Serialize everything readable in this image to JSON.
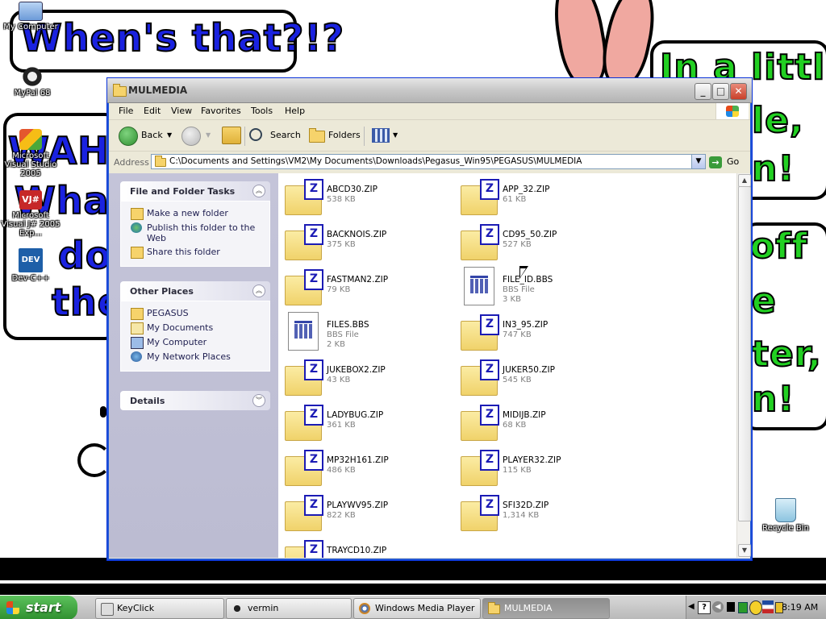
{
  "desktop": {
    "icons": [
      {
        "label": "My Computer"
      },
      {
        "label": "MyPal 68"
      },
      {
        "label": "Microsoft Visual Studio 2005"
      },
      {
        "label": "Microsoft Visual J# 2005 Exp..."
      },
      {
        "label": "Dev-C++"
      },
      {
        "label": "Recycle Bin"
      }
    ],
    "wallpaper_text": {
      "bubble1": "When's that?!?",
      "bubble2_line1": "WAHU",
      "bubble2_line2": "What",
      "bubble2_line3": "do",
      "bubble2_line4": "the",
      "bubble3_line1": "In a little",
      "bubble3_line2": "le,",
      "bubble3_line3": "n!",
      "bubble4_line1": "off",
      "bubble4_line2": "e",
      "bubble4_line3": "ter,",
      "bubble4_line4": "n!"
    }
  },
  "window": {
    "title": "MULMEDIA",
    "controls": {
      "minimize": "_",
      "maximize": "□",
      "close": "✕"
    },
    "menu": [
      "File",
      "Edit",
      "View",
      "Favorites",
      "Tools",
      "Help"
    ],
    "toolbar": {
      "back": "Back",
      "search": "Search",
      "folders": "Folders"
    },
    "address": {
      "label": "Address",
      "value": "C:\\Documents and Settings\\VM2\\My Documents\\Downloads\\Pegasus_Win95\\PEGASUS\\MULMEDIA",
      "go": "Go"
    },
    "tasks_panel": {
      "title": "File and Folder Tasks",
      "items": [
        "Make a new folder",
        "Publish this folder to the Web",
        "Share this folder"
      ]
    },
    "places_panel": {
      "title": "Other Places",
      "items": [
        "PEGASUS",
        "My Documents",
        "My Computer",
        "My Network Places"
      ]
    },
    "details_panel": {
      "title": "Details"
    },
    "files": [
      {
        "name": "ABCD30.ZIP",
        "size": "538 KB",
        "kind": "zip"
      },
      {
        "name": "APP_32.ZIP",
        "size": "61 KB",
        "kind": "zip"
      },
      {
        "name": "BACKNOIS.ZIP",
        "size": "375 KB",
        "kind": "zip"
      },
      {
        "name": "CD95_50.ZIP",
        "size": "527 KB",
        "kind": "zip"
      },
      {
        "name": "FASTMAN2.ZIP",
        "size": "79 KB",
        "kind": "zip"
      },
      {
        "name": "FILE_ID.BBS",
        "type": "BBS File",
        "size": "3 KB",
        "kind": "bbs"
      },
      {
        "name": "FILES.BBS",
        "type": "BBS File",
        "size": "2 KB",
        "kind": "bbs"
      },
      {
        "name": "IN3_95.ZIP",
        "size": "747 KB",
        "kind": "zip"
      },
      {
        "name": "JUKEBOX2.ZIP",
        "size": "43 KB",
        "kind": "zip"
      },
      {
        "name": "JUKER50.ZIP",
        "size": "545 KB",
        "kind": "zip"
      },
      {
        "name": "LADYBUG.ZIP",
        "size": "361 KB",
        "kind": "zip"
      },
      {
        "name": "MIDIJB.ZIP",
        "size": "68 KB",
        "kind": "zip"
      },
      {
        "name": "MP32H161.ZIP",
        "size": "486 KB",
        "kind": "zip"
      },
      {
        "name": "PLAYER32.ZIP",
        "size": "115 KB",
        "kind": "zip"
      },
      {
        "name": "PLAYWV95.ZIP",
        "size": "822 KB",
        "kind": "zip"
      },
      {
        "name": "SFI32D.ZIP",
        "size": "1,314 KB",
        "kind": "zip"
      },
      {
        "name": "TRAYCD10.ZIP",
        "size": "",
        "kind": "zip"
      }
    ]
  },
  "taskbar": {
    "start": "start",
    "tasks": [
      {
        "label": "KeyClick",
        "active": false
      },
      {
        "label": "vermin",
        "active": false
      },
      {
        "label": "Windows Media Player",
        "active": false
      },
      {
        "label": "MULMEDIA",
        "active": true
      }
    ],
    "clock": "8:19 AM"
  },
  "colors": {
    "accent": "#2257d6",
    "start_green": "#3a9b3a",
    "link_text": "#1e1e50"
  }
}
